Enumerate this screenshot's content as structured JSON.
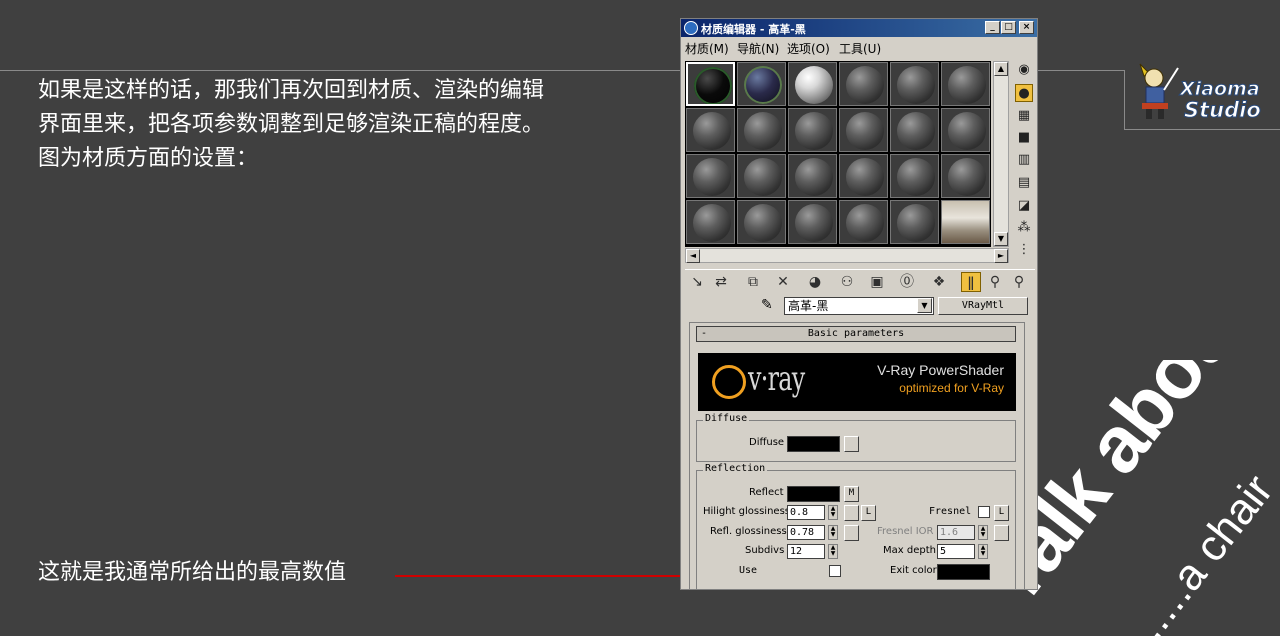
{
  "slide": {
    "intro_lines": [
      "如果是这样的话，那我们再次回到材质、渲染的编辑",
      "界面里来，把各项参数调整到足够渲染正稿的程度。",
      "图为材质方面的设置："
    ],
    "note": "这就是我通常所给出的最高数值",
    "logo": {
      "line1": "Xiaoma",
      "line2": "Studio"
    },
    "watermark": {
      "main": "Talk about",
      "sub": ".....a chair"
    },
    "colors": {
      "background": "#404040",
      "pointer_line": "#d00000"
    }
  },
  "window": {
    "title": "材质编辑器 - 高革-黑",
    "controls": {
      "minimize": "_",
      "maximize": "□",
      "close": "×"
    },
    "menu": [
      "材质(M)",
      "导航(N)",
      "选项(O)",
      "工具(U)"
    ],
    "material": {
      "name": "高革-黑",
      "type": "VRayMtl",
      "dropdown_arrow": "▼"
    },
    "scroll_arrows": {
      "up": "▲",
      "down": "▼",
      "left": "◄",
      "right": "►"
    },
    "rollout": {
      "collapse": "-",
      "title": "Basic parameters",
      "banner_logo": "v·ray",
      "banner_title": "V-Ray PowerShader",
      "banner_sub": "optimized for V-Ray"
    },
    "diffuse": {
      "group": "Diffuse",
      "label": "Diffuse",
      "color": "#000000"
    },
    "reflection": {
      "group": "Reflection",
      "reflect_label": "Reflect",
      "reflect_map": "M",
      "hilight_label": "Hilight glossiness",
      "hilight_value": "0.8",
      "hilight_lock": "L",
      "fresnel_label": "Fresnel",
      "fresnel_lock": "L",
      "refl_gloss_label": "Refl. glossiness",
      "refl_gloss_value": "0.78",
      "fresnel_ior_label": "Fresnel IOR",
      "fresnel_ior_value": "1.6",
      "subdivs_label": "Subdivs",
      "subdivs_value": "12",
      "max_depth_label": "Max depth",
      "max_depth_value": "5",
      "use_label": "Use",
      "exit_color_label": "Exit color",
      "exit_color": "#000000"
    },
    "icons": {
      "side": [
        "sample-sphere-icon",
        "backlight-icon",
        "checker-background-icon",
        "sample-uv-icon",
        "video-color-check-icon",
        "make-preview-icon",
        "options-icon",
        "select-by-material-icon",
        "material-map-navigator-icon"
      ],
      "toolbar": [
        "get-material-icon",
        "put-to-scene-icon",
        "assign-to-selection-icon",
        "reset-map-icon",
        "make-copy-icon",
        "make-unique-icon",
        "put-to-library-icon",
        "material-effects-channel-icon",
        "show-map-in-viewport-icon",
        "show-end-result-icon",
        "go-to-parent-icon",
        "go-forward-to-sibling-icon"
      ]
    }
  }
}
